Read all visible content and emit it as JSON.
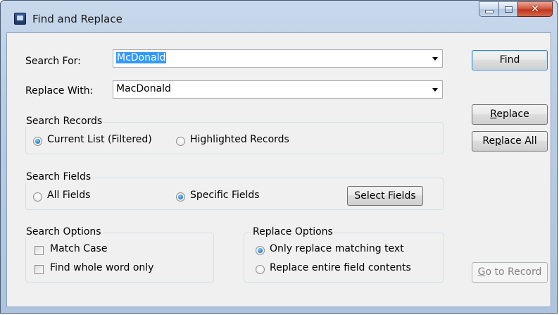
{
  "window": {
    "title": "Find and Replace"
  },
  "search_for": {
    "label": "Search For:",
    "value": "McDonald"
  },
  "replace_with": {
    "label": "Replace With:",
    "value": "MacDonald"
  },
  "buttons": {
    "find": "Find",
    "replace_underline": "R",
    "replace_rest": "eplace",
    "replace_all_pre": "Re",
    "replace_all_u": "p",
    "replace_all_rest": "lace All",
    "go_to_u": "G",
    "go_to_rest": "o to Record",
    "select_fields": "Select Fields"
  },
  "search_records": {
    "title": "Search Records",
    "options": [
      {
        "label": "Current List (Filtered)",
        "checked": true
      },
      {
        "label": "Highlighted Records",
        "checked": false
      }
    ]
  },
  "search_fields": {
    "title": "Search Fields",
    "options": [
      {
        "label": "All Fields",
        "checked": false
      },
      {
        "label": "Specific Fields",
        "checked": true
      }
    ]
  },
  "search_options": {
    "title": "Search Options",
    "options": [
      {
        "label": "Match Case",
        "checked": false
      },
      {
        "label": "Find whole word only",
        "checked": false
      }
    ]
  },
  "replace_options": {
    "title": "Replace Options",
    "options": [
      {
        "label": "Only replace matching text",
        "checked": true
      },
      {
        "label": "Replace entire field contents",
        "checked": false
      }
    ]
  }
}
